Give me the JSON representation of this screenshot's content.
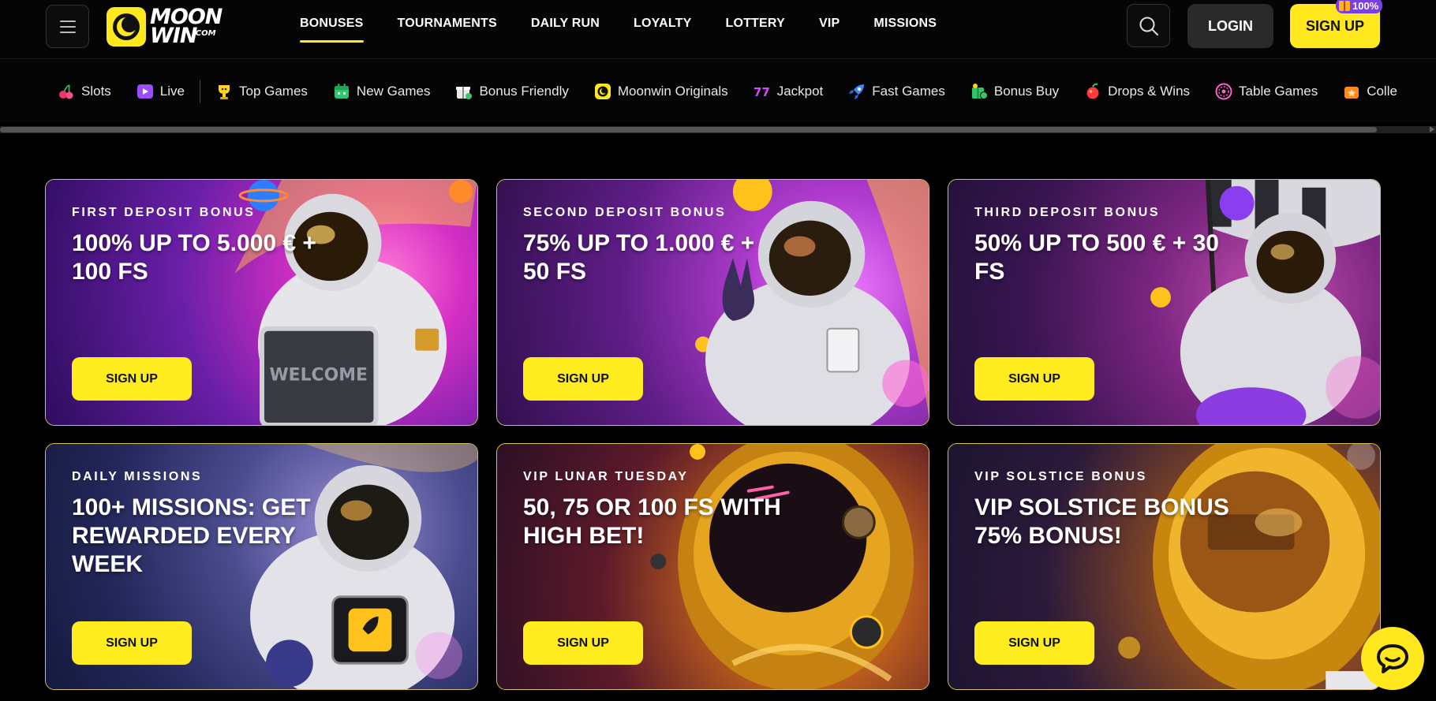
{
  "brand": {
    "line1": "MOON",
    "line2": "WIN",
    "suffix": ".COM",
    "accent": "#ffe81d"
  },
  "header": {
    "nav": [
      {
        "label": "BONUSES",
        "active": true
      },
      {
        "label": "TOURNAMENTS",
        "active": false
      },
      {
        "label": "DAILY RUN",
        "active": false
      },
      {
        "label": "LOYALTY",
        "active": false
      },
      {
        "label": "LOTTERY",
        "active": false
      },
      {
        "label": "VIP",
        "active": false
      },
      {
        "label": "MISSIONS",
        "active": false
      }
    ],
    "login_label": "LOGIN",
    "signup_label": "SIGN UP",
    "signup_badge": "100%"
  },
  "categories": [
    {
      "label": "Slots",
      "icon": "cherry-icon"
    },
    {
      "label": "Live",
      "icon": "play-icon"
    },
    {
      "label": "Top Games",
      "icon": "trophy-icon"
    },
    {
      "label": "New Games",
      "icon": "calendar-icon"
    },
    {
      "label": "Bonus Friendly",
      "icon": "gift-icon"
    },
    {
      "label": "Moonwin Originals",
      "icon": "moonwin-icon"
    },
    {
      "label": "Jackpot",
      "icon": "jackpot-icon"
    },
    {
      "label": "Fast Games",
      "icon": "rocket-icon"
    },
    {
      "label": "Bonus Buy",
      "icon": "bonus-buy-icon"
    },
    {
      "label": "Drops & Wins",
      "icon": "drops-icon"
    },
    {
      "label": "Table Games",
      "icon": "roulette-icon"
    },
    {
      "label": "Colle",
      "icon": "collection-icon"
    }
  ],
  "bonuses": [
    {
      "kicker": "FIRST DEPOSIT BONUS",
      "headline": "100% UP TO 5.000 € + 100 FS",
      "cta": "SIGN UP",
      "theme": "purple-pink"
    },
    {
      "kicker": "SECOND DEPOSIT BONUS",
      "headline": "75% UP TO 1.000 € + 50 FS",
      "cta": "SIGN UP",
      "theme": "purple-gold"
    },
    {
      "kicker": "THIRD DEPOSIT BONUS",
      "headline": "50% UP TO 500 € + 30 FS",
      "cta": "SIGN UP",
      "theme": "violet-red"
    },
    {
      "kicker": "DAILY MISSIONS",
      "headline": "100+ MISSIONS: GET REWARDED EVERY WEEK",
      "cta": "SIGN UP",
      "theme": "blue-gold"
    },
    {
      "kicker": "VIP LUNAR TUESDAY",
      "headline": "50, 75 OR 100 FS WITH HIGH BET!",
      "cta": "SIGN UP",
      "theme": "maroon-gold"
    },
    {
      "kicker": "VIP SOLSTICE BONUS",
      "headline": "VIP SOLSTICE BONUS 75% BONUS!",
      "cta": "SIGN UP",
      "theme": "navy-gold"
    }
  ],
  "colors": {
    "accent_yellow": "#ffe81d",
    "card_border": "#d8c15c",
    "background": "#000000"
  }
}
